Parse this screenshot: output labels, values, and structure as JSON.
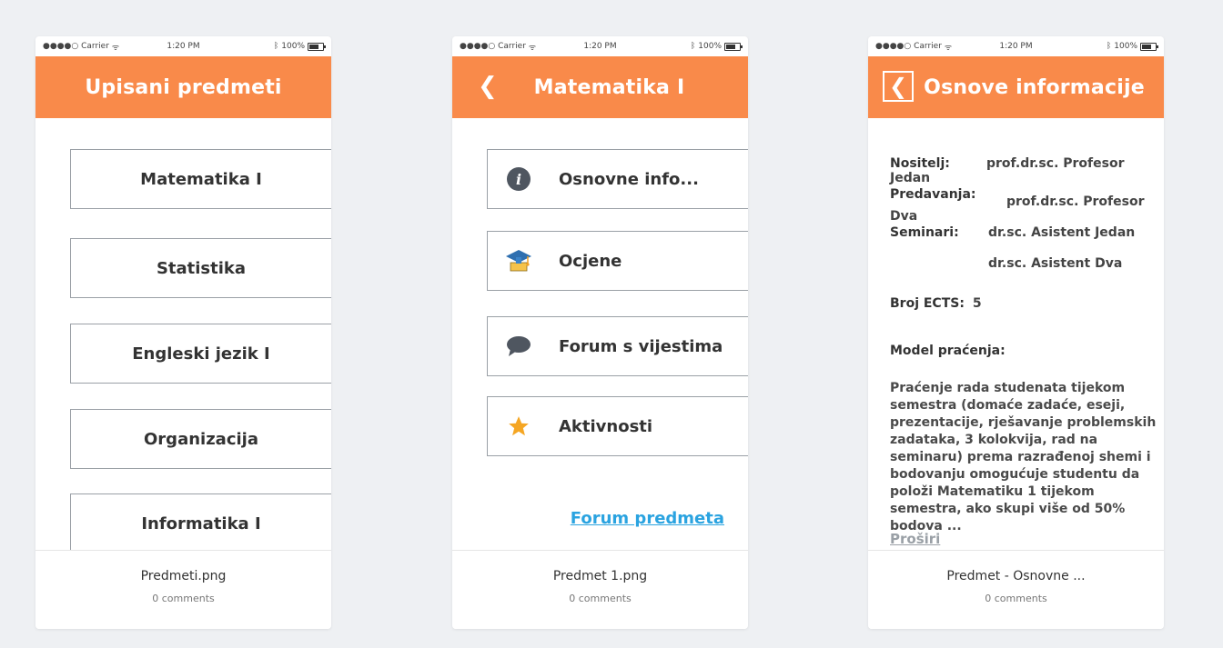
{
  "status": {
    "carrier": "●●●●○ Carrier",
    "time": "1:20 PM",
    "battery": "100%"
  },
  "screens": {
    "predmeti": {
      "title": "Upisani predmeti",
      "subjects": [
        "Matematika I",
        "Statistika",
        "Engleski jezik I",
        "Organizacija",
        "Informatika I"
      ],
      "footer_name": "Predmeti.png",
      "footer_comments": "0 comments"
    },
    "predmet": {
      "title": "Matematika I",
      "back_icon": "chevron-left-icon",
      "menu": [
        {
          "label": "Osnovne info...",
          "icon": "info-icon"
        },
        {
          "label": "Ocjene",
          "icon": "graduation-cap-icon"
        },
        {
          "label": "Forum s vijestima",
          "icon": "speech-bubble-icon"
        },
        {
          "label": "Aktivnosti",
          "icon": "star-icon"
        }
      ],
      "forum_link": "Forum predmeta",
      "footer_name": "Predmet 1.png",
      "footer_comments": "0 comments"
    },
    "osnovne": {
      "title": "Osnove informacije",
      "back_icon": "chevron-left-icon",
      "nositelj_label": "Nositelj:",
      "nositelj": "prof.dr.sc. Profesor Jedan",
      "predavanja_label": "Predavanja:",
      "predavanja": "prof.dr.sc. Profesor Dva",
      "seminari_label": "Seminari:",
      "seminari_1": "dr.sc. Asistent Jedan",
      "seminari_2": "dr.sc. Asistent Dva",
      "ects_label": "Broj ECTS:",
      "ects": "5",
      "model_label": "Model praćenja:",
      "model_text": "Praćenje rada studenata tijekom semestra (domaće zadaće, eseji, prezentacije, rješavanje problemskih zadataka, 3 kolokvija, rad na seminaru) prema razrađenoj shemi i bodovanju omogućuje studentu da položi Matematiku 1 tijekom semestra, ako skupi više od 50% bodova ...",
      "expand": "Proširi",
      "footer_name": "Predmet - Osnovne ...",
      "footer_comments": "0 comments"
    }
  },
  "colors": {
    "accent": "#f98a4a",
    "link": "#2aa3e0",
    "star": "#f5a623"
  }
}
